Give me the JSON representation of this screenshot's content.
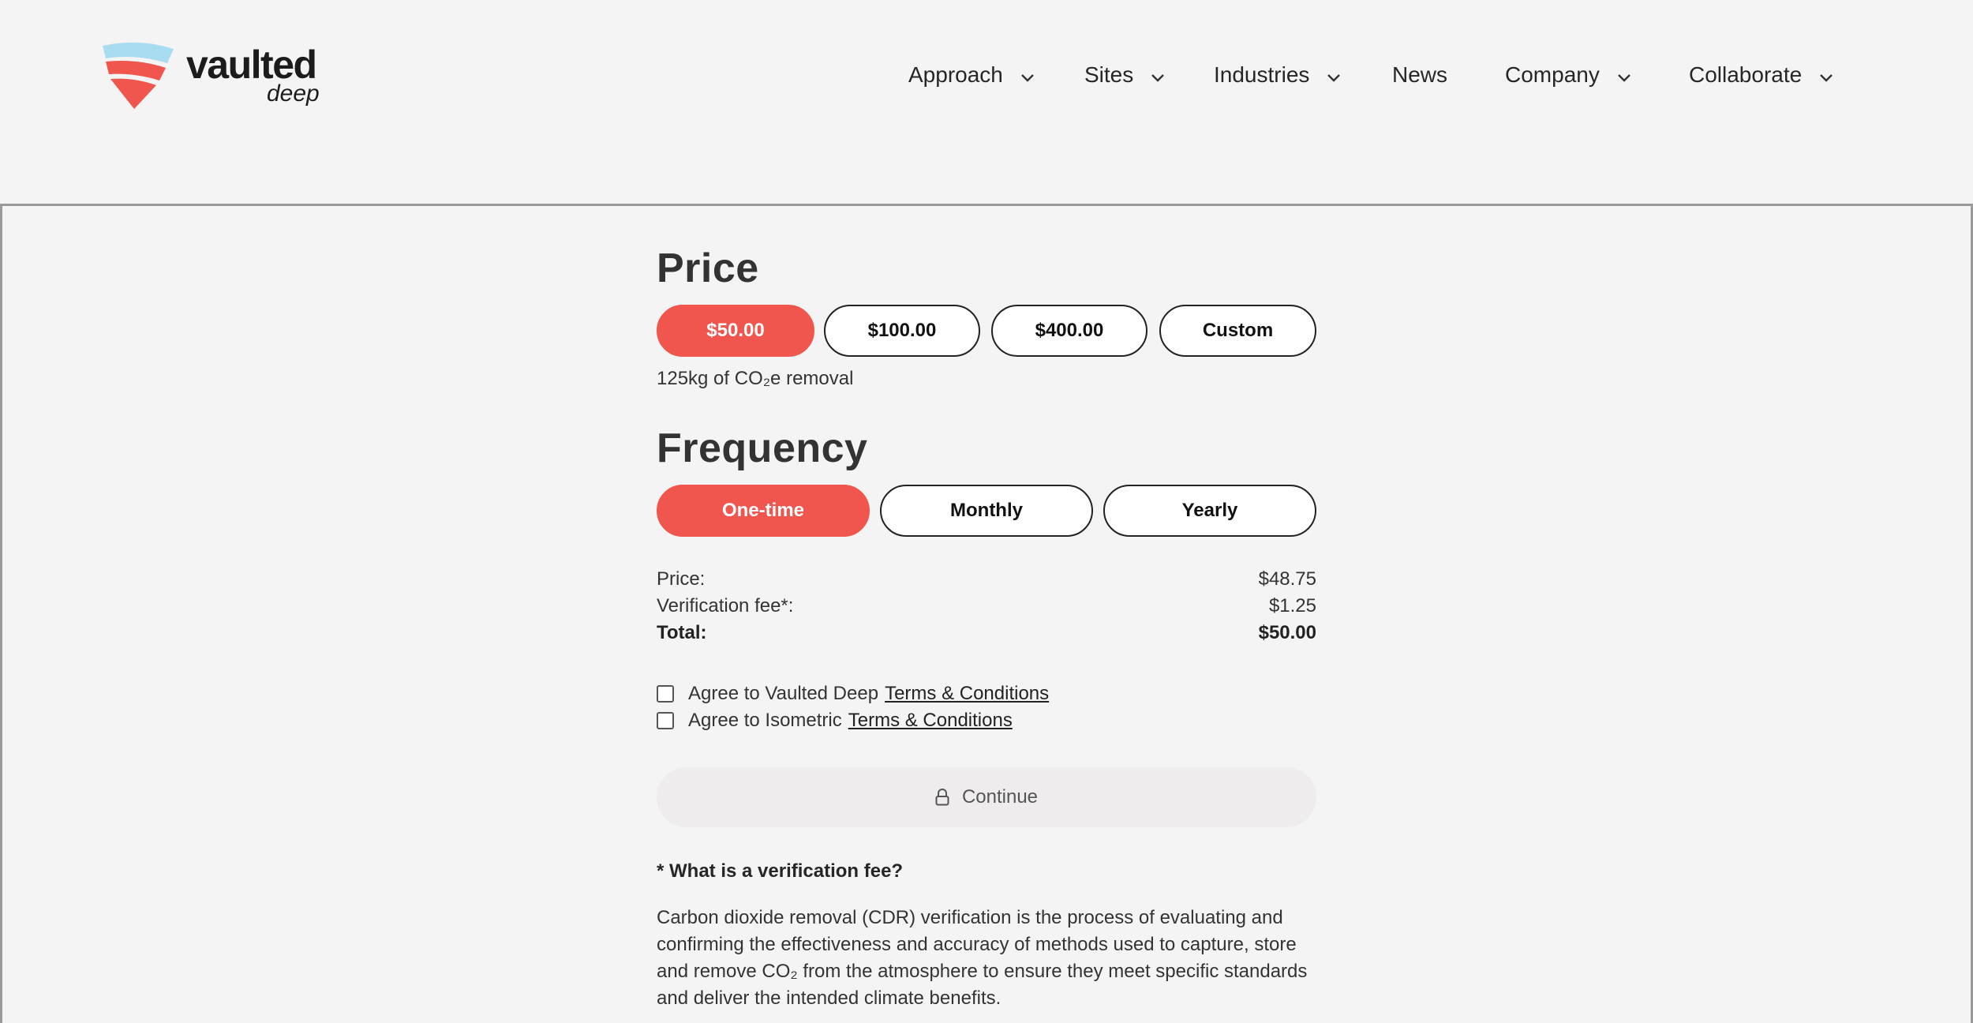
{
  "brand": {
    "name": "vaulted",
    "sub": "deep"
  },
  "nav": {
    "items": [
      {
        "label": "Approach",
        "has_dropdown": true
      },
      {
        "label": "Sites",
        "has_dropdown": true
      },
      {
        "label": "Industries",
        "has_dropdown": true
      },
      {
        "label": "News",
        "has_dropdown": false
      },
      {
        "label": "Company",
        "has_dropdown": true
      },
      {
        "label": "Collaborate",
        "has_dropdown": true
      }
    ]
  },
  "price": {
    "title": "Price",
    "options": [
      "$50.00",
      "$100.00",
      "$400.00",
      "Custom"
    ],
    "selected": "$50.00",
    "note": "125kg of CO₂e removal"
  },
  "frequency": {
    "title": "Frequency",
    "options": [
      "One-time",
      "Monthly",
      "Yearly"
    ],
    "selected": "One-time"
  },
  "summary": {
    "price_label": "Price:",
    "price_value": "$48.75",
    "fee_label": "Verification fee*:",
    "fee_value": "$1.25",
    "total_label": "Total:",
    "total_value": "$50.00"
  },
  "agreements": [
    {
      "text": "Agree to Vaulted Deep",
      "link": "Terms & Conditions",
      "checked": false
    },
    {
      "text": "Agree to Isometric",
      "link": "Terms & Conditions",
      "checked": false
    }
  ],
  "continue_label": "Continue",
  "faq": {
    "question": "* What is a verification fee?",
    "answer": "Carbon dioxide removal (CDR) verification is the process of evaluating and confirming the effectiveness and accuracy of methods used to capture, store and remove CO₂ from the atmosphere to ensure they meet specific standards and deliver the intended climate benefits."
  },
  "colors": {
    "accent": "#f0564d",
    "logo_light": "#a8dcf0",
    "background": "#f4f4f4"
  },
  "icons": [
    "chevron-down-icon",
    "lock-icon",
    "vaulted-deep-logo"
  ]
}
